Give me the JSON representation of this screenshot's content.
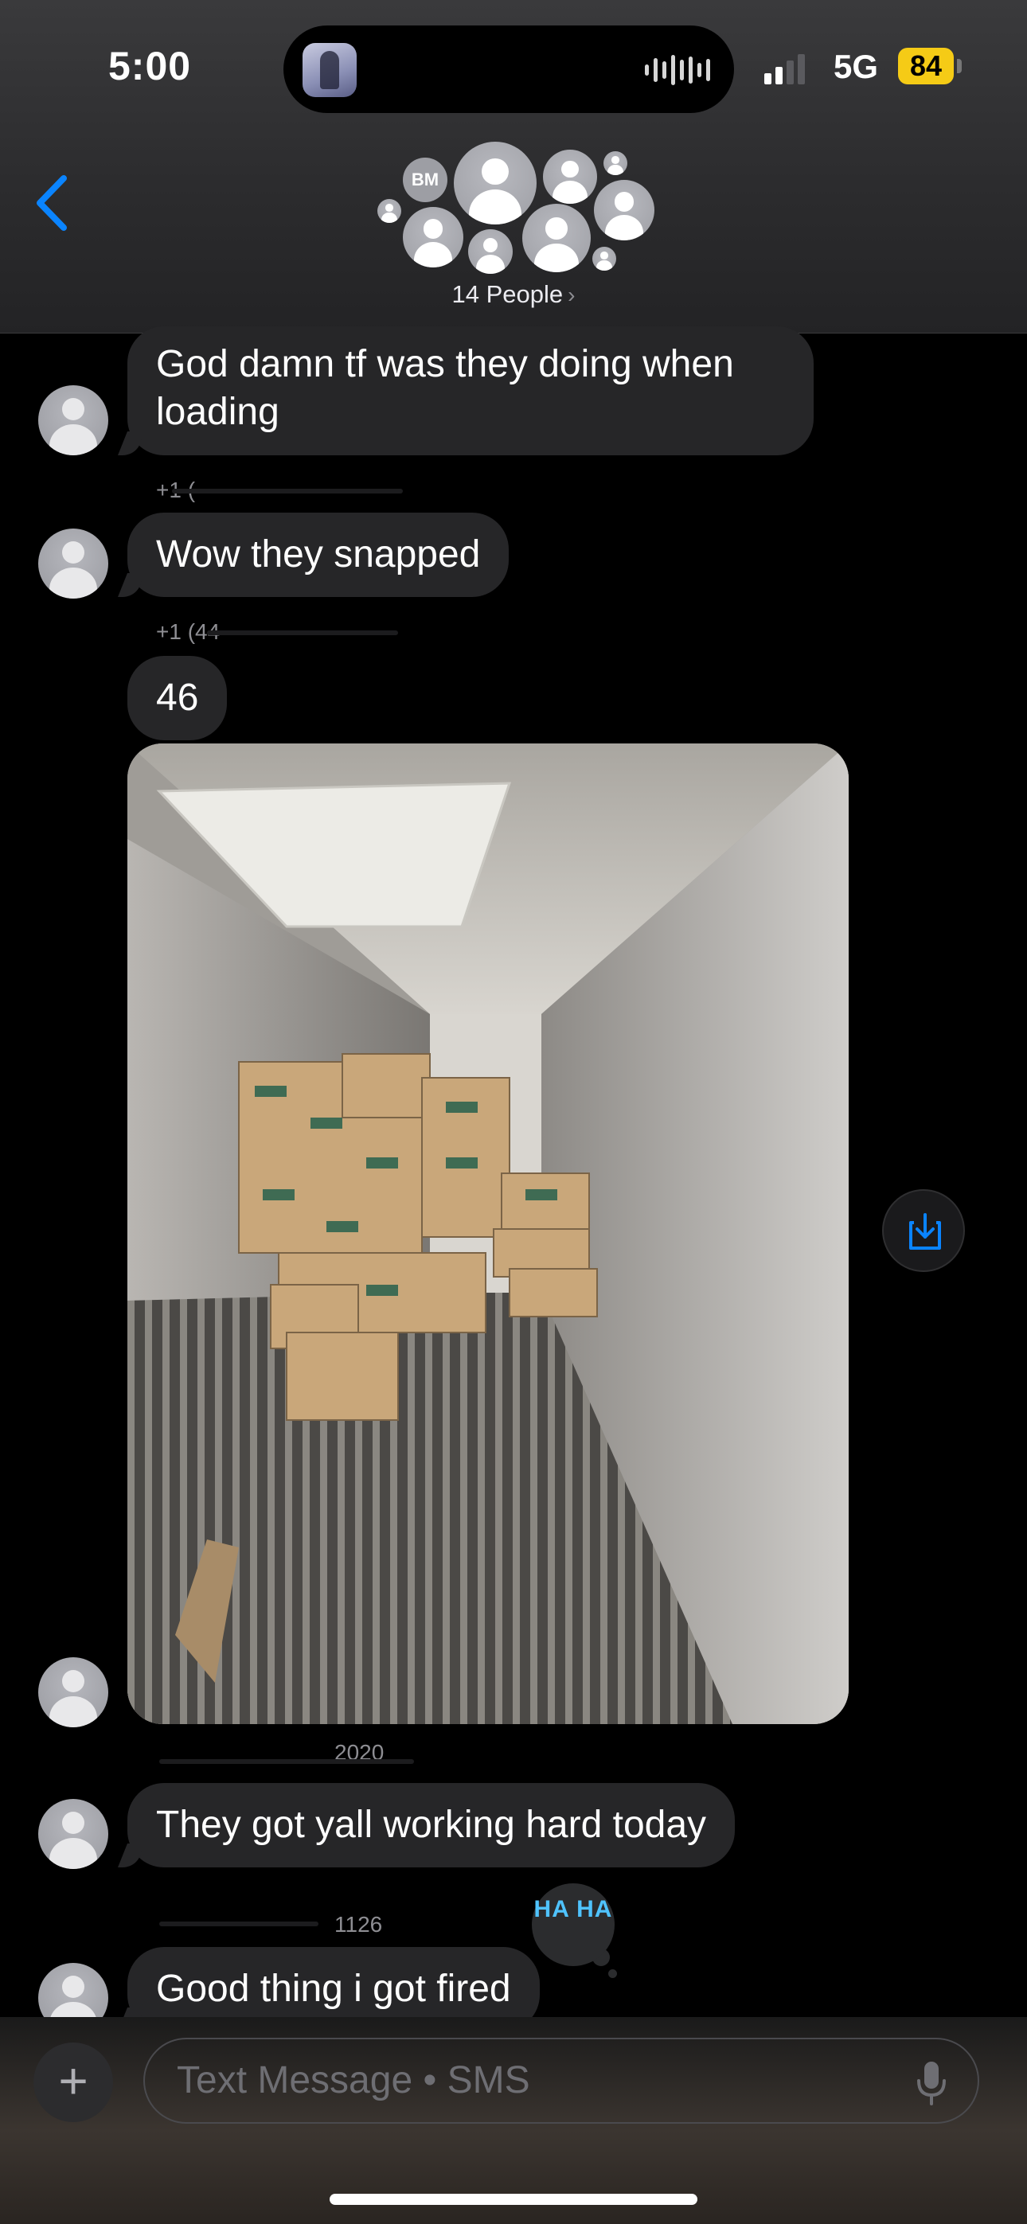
{
  "status_bar": {
    "time": "5:00",
    "network": "5G",
    "battery": "84"
  },
  "header": {
    "back_icon": "chevron-left-icon",
    "avatar_initials": "BM",
    "people_label": "14 People",
    "people_chevron": "›",
    "accent_color": "#0a84ff"
  },
  "messages": [
    {
      "text_line1": "God damn tf was they doing when",
      "text_line2": "loading"
    },
    {
      "text": "Wow they snapped"
    },
    {
      "text": "46"
    },
    {
      "attachment": "photo",
      "attachment_subject": "inside of a trailer with cardboard boxes"
    },
    {
      "text": "They got yall working hard today"
    },
    {
      "text": "Good thing i got fired",
      "tapback_text": "HA HA"
    }
  ],
  "sender_fragments": {
    "f1": "+1 (",
    "f2": "+1 (44",
    "f3": "2020",
    "f4": "1126"
  },
  "composer": {
    "plus_label": "+",
    "placeholder": "Text Message • SMS"
  },
  "colors": {
    "bubble": "#262628",
    "background": "#000000",
    "battery": "#f5cb16",
    "tapback_text": "#4fc3ff"
  }
}
